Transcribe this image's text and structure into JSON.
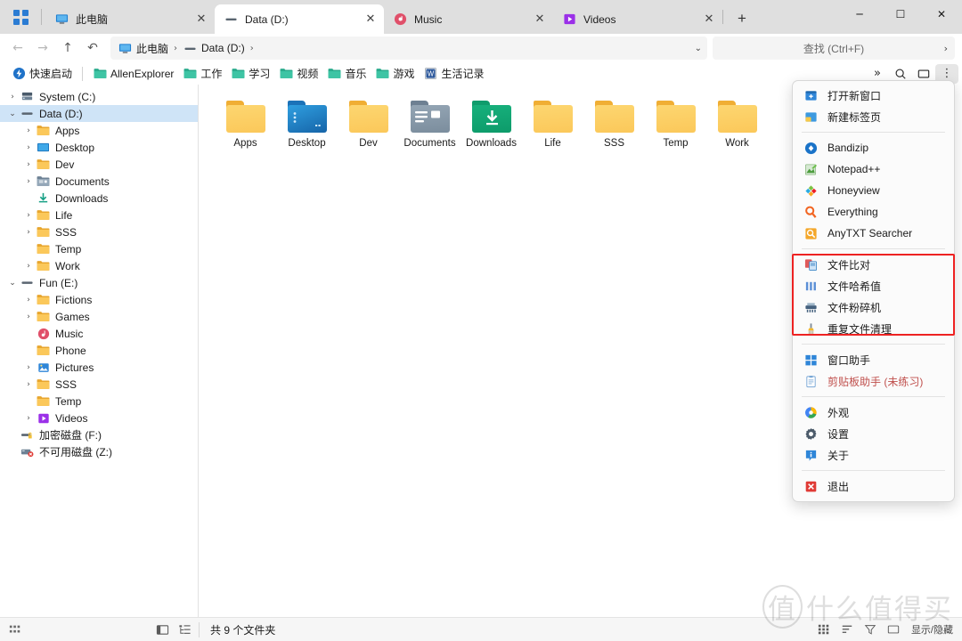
{
  "window": {
    "minimize_label": "─",
    "maximize_label": "☐",
    "close_label": "✕",
    "waffle_name": "app-grid"
  },
  "tabs": [
    {
      "label": "此电脑",
      "icon": "this-pc-icon",
      "active": false,
      "close_label": "✕"
    },
    {
      "label": "Data (D:)",
      "icon": "drive-icon",
      "active": true,
      "close_label": "✕"
    },
    {
      "label": "Music",
      "icon": "music-icon",
      "active": false,
      "close_label": "✕"
    },
    {
      "label": "Videos",
      "icon": "videos-icon",
      "active": false,
      "close_label": "✕"
    }
  ],
  "new_tab_label": "+",
  "nav": {
    "back": "←",
    "forward": "→",
    "up": "↑",
    "refresh": "↶"
  },
  "breadcrumb": {
    "items": [
      {
        "label": "此电脑",
        "icon": "this-pc-icon"
      },
      {
        "label": "Data (D:)",
        "icon": "drive-icon"
      }
    ],
    "separator": "›",
    "caret": "⌄"
  },
  "search": {
    "placeholder": "查找 (Ctrl+F)",
    "arrow": "›"
  },
  "bookmarks": {
    "quick_launch": {
      "label": "快速启动",
      "icon": "quick-launch-icon"
    },
    "items": [
      {
        "label": "AllenExplorer",
        "icon": "folder-icon"
      },
      {
        "label": "工作",
        "icon": "folder-icon"
      },
      {
        "label": "学习",
        "icon": "folder-icon"
      },
      {
        "label": "视频",
        "icon": "folder-icon"
      },
      {
        "label": "音乐",
        "icon": "folder-icon"
      },
      {
        "label": "游戏",
        "icon": "folder-icon"
      },
      {
        "label": "生活记录",
        "icon": "word-doc-icon"
      }
    ],
    "right_buttons": [
      {
        "name": "chevrons-down-icon",
        "glyph": "»"
      },
      {
        "name": "search-icon",
        "glyph": "⚲"
      },
      {
        "name": "panel-toggle-icon",
        "glyph": "▭"
      },
      {
        "name": "more-menu-icon",
        "glyph": "⋮"
      }
    ]
  },
  "sidebar": {
    "items": [
      {
        "label": "System (C:)",
        "indent": 0,
        "chevron": "›",
        "icon": "hdd-icon",
        "selected": false
      },
      {
        "label": "Data (D:)",
        "indent": 0,
        "chevron": "⌄",
        "icon": "drive-icon",
        "selected": true
      },
      {
        "label": "Apps",
        "indent": 1,
        "chevron": "›",
        "icon": "folder-yellow-icon",
        "selected": false
      },
      {
        "label": "Desktop",
        "indent": 1,
        "chevron": "›",
        "icon": "desktop-icon",
        "selected": false
      },
      {
        "label": "Dev",
        "indent": 1,
        "chevron": "›",
        "icon": "folder-yellow-icon",
        "selected": false
      },
      {
        "label": "Documents",
        "indent": 1,
        "chevron": "›",
        "icon": "documents-icon",
        "selected": false
      },
      {
        "label": "Downloads",
        "indent": 1,
        "chevron": "",
        "icon": "downloads-icon",
        "selected": false
      },
      {
        "label": "Life",
        "indent": 1,
        "chevron": "›",
        "icon": "folder-yellow-icon",
        "selected": false
      },
      {
        "label": "SSS",
        "indent": 1,
        "chevron": "›",
        "icon": "folder-yellow-icon",
        "selected": false
      },
      {
        "label": "Temp",
        "indent": 1,
        "chevron": "",
        "icon": "folder-yellow-icon",
        "selected": false
      },
      {
        "label": "Work",
        "indent": 1,
        "chevron": "›",
        "icon": "folder-yellow-icon",
        "selected": false
      },
      {
        "label": "Fun (E:)",
        "indent": 0,
        "chevron": "⌄",
        "icon": "drive-icon",
        "selected": false
      },
      {
        "label": "Fictions",
        "indent": 1,
        "chevron": "›",
        "icon": "folder-yellow-icon",
        "selected": false
      },
      {
        "label": "Games",
        "indent": 1,
        "chevron": "›",
        "icon": "folder-yellow-icon",
        "selected": false
      },
      {
        "label": "Music",
        "indent": 1,
        "chevron": "",
        "icon": "music-icon",
        "selected": false
      },
      {
        "label": "Phone",
        "indent": 1,
        "chevron": "",
        "icon": "folder-yellow-icon",
        "selected": false
      },
      {
        "label": "Pictures",
        "indent": 1,
        "chevron": "›",
        "icon": "pictures-icon",
        "selected": false
      },
      {
        "label": "SSS",
        "indent": 1,
        "chevron": "›",
        "icon": "folder-yellow-icon",
        "selected": false
      },
      {
        "label": "Temp",
        "indent": 1,
        "chevron": "",
        "icon": "folder-yellow-icon",
        "selected": false
      },
      {
        "label": "Videos",
        "indent": 1,
        "chevron": "›",
        "icon": "videos-icon",
        "selected": false
      },
      {
        "label": "加密磁盘 (F:)",
        "indent": 0,
        "chevron": "",
        "icon": "encrypted-drive-icon",
        "selected": false
      },
      {
        "label": "不可用磁盘 (Z:)",
        "indent": 0,
        "chevron": "",
        "icon": "unavailable-drive-icon",
        "selected": false
      }
    ]
  },
  "files": [
    {
      "name": "Apps",
      "icon": "folder-yellow"
    },
    {
      "name": "Desktop",
      "icon": "folder-desktop"
    },
    {
      "name": "Dev",
      "icon": "folder-yellow"
    },
    {
      "name": "Documents",
      "icon": "folder-documents"
    },
    {
      "name": "Downloads",
      "icon": "folder-downloads"
    },
    {
      "name": "Life",
      "icon": "folder-yellow"
    },
    {
      "name": "SSS",
      "icon": "folder-yellow"
    },
    {
      "name": "Temp",
      "icon": "folder-yellow"
    },
    {
      "name": "Work",
      "icon": "folder-yellow"
    }
  ],
  "context_menu": {
    "groups": [
      {
        "items": [
          {
            "label": "打开新窗口",
            "icon": "new-window-icon",
            "muted": false
          },
          {
            "label": "新建标签页",
            "icon": "new-tab-icon",
            "muted": false
          }
        ]
      },
      {
        "items": [
          {
            "label": "Bandizip",
            "icon": "bandizip-icon",
            "muted": false
          },
          {
            "label": "Notepad++",
            "icon": "notepadpp-icon",
            "muted": false
          },
          {
            "label": "Honeyview",
            "icon": "honeyview-icon",
            "muted": false
          },
          {
            "label": "Everything",
            "icon": "everything-icon",
            "muted": false
          },
          {
            "label": "AnyTXT Searcher",
            "icon": "anytxt-icon",
            "muted": false
          }
        ]
      },
      {
        "highlighted": true,
        "items": [
          {
            "label": "文件比对",
            "icon": "file-compare-icon",
            "muted": false
          },
          {
            "label": "文件哈希值",
            "icon": "file-hash-icon",
            "muted": false
          },
          {
            "label": "文件粉碎机",
            "icon": "file-shredder-icon",
            "muted": false
          },
          {
            "label": "重复文件清理",
            "icon": "duplicate-cleaner-icon",
            "muted": false
          }
        ]
      },
      {
        "items": [
          {
            "label": "窗口助手",
            "icon": "window-assistant-icon",
            "muted": false
          },
          {
            "label": "剪贴板助手 (未练习)",
            "icon": "clipboard-assistant-icon",
            "muted": true
          }
        ]
      },
      {
        "items": [
          {
            "label": "外观",
            "icon": "appearance-icon",
            "muted": false
          },
          {
            "label": "设置",
            "icon": "settings-gear-icon",
            "muted": false
          },
          {
            "label": "关于",
            "icon": "about-info-icon",
            "muted": false
          }
        ]
      },
      {
        "items": [
          {
            "label": "退出",
            "icon": "exit-icon",
            "muted": false
          }
        ]
      }
    ],
    "highlight_color": "#ee2222"
  },
  "status": {
    "count_text": "共 9 个文件夹",
    "left_icon": "columns-icon",
    "sidebar_buttons": [
      {
        "name": "collapse-panel-icon",
        "glyph": "⌷"
      },
      {
        "name": "tree-view-icon",
        "glyph": "☰"
      }
    ],
    "view_buttons": [
      {
        "name": "grid-view-icon",
        "glyph": "▒"
      },
      {
        "name": "sort-icon",
        "glyph": "≡"
      },
      {
        "name": "filter-icon",
        "glyph": "▽"
      },
      {
        "name": "details-pane-icon",
        "glyph": "▭"
      }
    ],
    "hidden_toggle_label": "显示/隐藏"
  },
  "watermark": {
    "mark": "值",
    "text": "什么值得买"
  },
  "colors": {
    "accent": "#2b7cd3",
    "selection": "#cfe4f7",
    "tab_bar": "#dfdfdf",
    "folder_yellow": "#fbc85a",
    "highlight_red": "#ee2222"
  }
}
